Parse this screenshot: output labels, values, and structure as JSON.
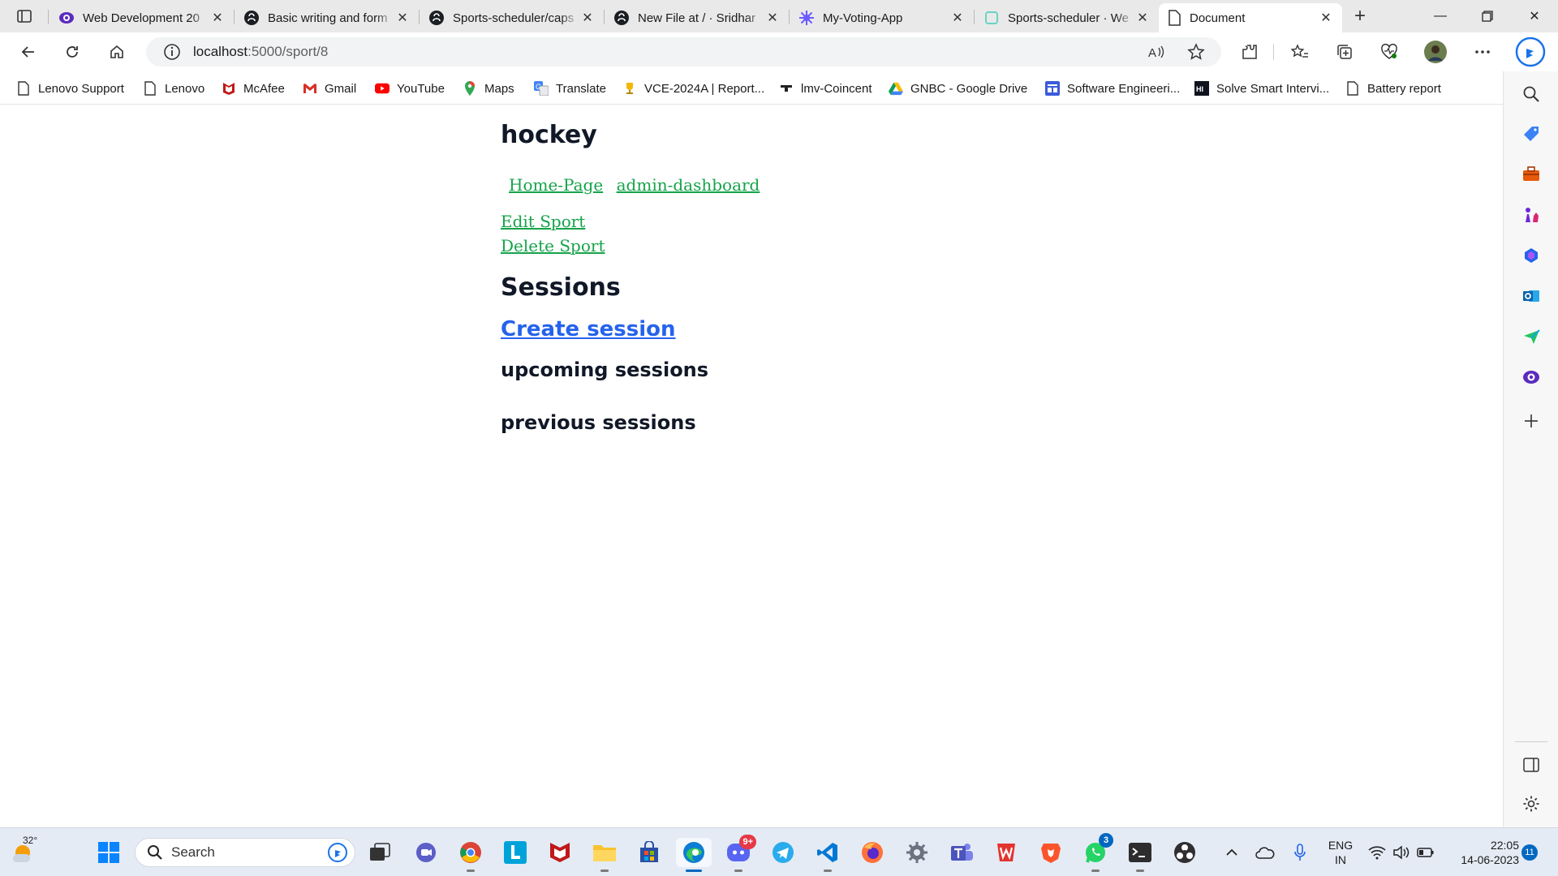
{
  "tabs": [
    {
      "title": "Web Development 20",
      "icon": "eye-icon"
    },
    {
      "title": "Basic writing and form",
      "icon": "github-icon"
    },
    {
      "title": "Sports-scheduler/caps",
      "icon": "github-icon"
    },
    {
      "title": "New File at / · Sridhar",
      "icon": "github-icon"
    },
    {
      "title": "My-Voting-App",
      "icon": "gear-flower-icon"
    },
    {
      "title": "Sports-scheduler · We",
      "icon": "loading-icon"
    },
    {
      "title": "Document",
      "icon": "page-icon",
      "active": true
    }
  ],
  "address": {
    "host": "localhost",
    "path": ":5000/sport/8"
  },
  "bookmarks": [
    {
      "label": "Lenovo Support",
      "icon": "page-icon"
    },
    {
      "label": "Lenovo",
      "icon": "page-icon"
    },
    {
      "label": "McAfee",
      "icon": "mcafee-icon"
    },
    {
      "label": "Gmail",
      "icon": "gmail-icon"
    },
    {
      "label": "YouTube",
      "icon": "youtube-icon"
    },
    {
      "label": "Maps",
      "icon": "maps-icon"
    },
    {
      "label": "Translate",
      "icon": "translate-icon"
    },
    {
      "label": "VCE-2024A | Report...",
      "icon": "trophy-icon"
    },
    {
      "label": "lmv-Coincent",
      "icon": "dash-icon"
    },
    {
      "label": "GNBC - Google Drive",
      "icon": "drive-icon"
    },
    {
      "label": "Software Engineeri...",
      "icon": "form-icon"
    },
    {
      "label": "Solve Smart Intervi...",
      "icon": "hackerrank-icon"
    },
    {
      "label": "Battery report",
      "icon": "page-icon"
    }
  ],
  "page": {
    "sport_name": "hockey",
    "nav": {
      "home": "Home-Page",
      "admin": "admin-dashboard"
    },
    "edit_sport": "Edit Sport",
    "delete_sport": "Delete Sport",
    "sessions_heading": "Sessions",
    "create_session": "Create session",
    "upcoming_heading": "upcoming sessions",
    "previous_heading": "previous sessions"
  },
  "taskbar": {
    "weather_temp": "32°",
    "search_placeholder": "Search",
    "discord_badge": "9+",
    "whatsapp_badge": "3",
    "lang_line1": "ENG",
    "lang_line2": "IN",
    "time": "22:05",
    "date": "14-06-2023",
    "notifications": "11"
  },
  "colors": {
    "link_green": "#16a34a",
    "link_blue": "#2563eb",
    "heading": "#111827"
  }
}
